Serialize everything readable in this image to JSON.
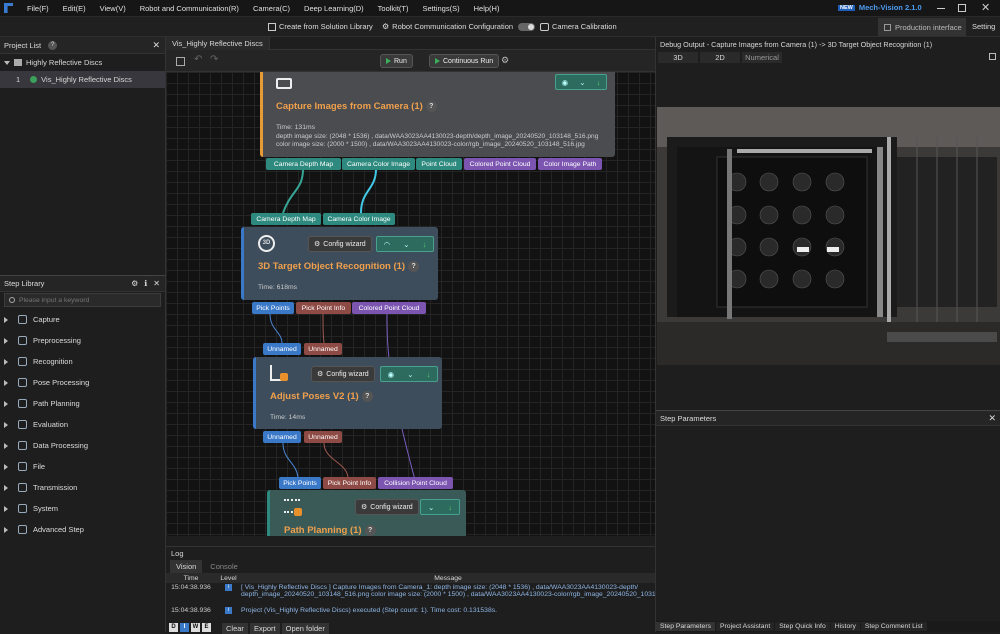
{
  "menu": [
    "File(F)",
    "Edit(E)",
    "View(V)",
    "Robot and Communication(R)",
    "Camera(C)",
    "Deep Learning(D)",
    "Toolkit(T)",
    "Settings(S)",
    "Help(H)"
  ],
  "app_badge": "NEW",
  "app_title": "Mech-Vision 2.1.0",
  "toolbar": {
    "create_solution": "Create from Solution Library",
    "robot_comm": "Robot Communication Configuration",
    "camera_calib": "Camera Calibration",
    "production_interface": "Production interface",
    "setting": "Setting"
  },
  "project_list": {
    "title": "Project List",
    "root": "Highly Reflective Discs",
    "items": [
      {
        "index": "1",
        "label": "Vis_Highly Reflective Discs"
      }
    ]
  },
  "step_library": {
    "title": "Step Library",
    "search_placeholder": "Please input a keyword",
    "items": [
      "Capture",
      "Preprocessing",
      "Recognition",
      "Pose Processing",
      "Path Planning",
      "Evaluation",
      "Data Processing",
      "File",
      "Transmission",
      "System",
      "Advanced Step"
    ]
  },
  "editor": {
    "tab": "Vis_Highly Reflective Discs",
    "run": "Run",
    "continuous_run": "Continuous Run"
  },
  "nodes": {
    "capture": {
      "title": "Capture Images from Camera (1)",
      "time": "Time: 131ms",
      "line1": "depth image size: (2048 * 1536) , data/WAA3023AA4130023-depth/depth_image_20240520_103148_516.png",
      "line2": "color image size: (2000 * 1500) , data/WAA3023AA4130023-color/rgb_image_20240520_103148_516.jpg",
      "outputs": [
        "Camera Depth Map",
        "Camera Color Image",
        "Point Cloud",
        "Colored Point Cloud",
        "Color Image Path"
      ]
    },
    "recog": {
      "inputs": [
        "Camera Depth Map",
        "Camera Color Image"
      ],
      "title": "3D Target Object Recognition (1)",
      "config": "Config wizard",
      "time": "Time: 618ms",
      "outputs": [
        "Pick Points",
        "Pick Point Info",
        "Colored Point Cloud"
      ]
    },
    "adjust": {
      "inputs": [
        "Unnamed",
        "Unnamed"
      ],
      "title": "Adjust Poses V2 (1)",
      "config": "Config wizard",
      "time": "Time: 14ms",
      "outputs": [
        "Unnamed",
        "Unnamed"
      ]
    },
    "path": {
      "inputs": [
        "Pick Points",
        "Pick Point Info",
        "Collision Point Cloud"
      ],
      "title": "Path Planning (1)",
      "config": "Config wizard"
    }
  },
  "debug": {
    "title": "Debug Output - Capture Images from Camera (1) -> 3D Target Object Recognition (1)",
    "tabs": [
      "3D",
      "2D",
      "Numerical"
    ]
  },
  "step_params": {
    "title": "Step Parameters",
    "bottom_tabs": [
      "Step Parameters",
      "Project Assistant",
      "Step Quick Info",
      "History",
      "Step Comment List"
    ]
  },
  "log": {
    "title": "Log",
    "tabs": [
      "Vision",
      "Console"
    ],
    "headers": [
      "Time",
      "Level",
      "Message"
    ],
    "rows": [
      {
        "time": "15:04:38.936",
        "msg1": "[ Vis_Highly Reflective Discs ] Capture Images from Camera_1: depth image size: (2048 * 1536) , data/WAA3023AA4130023-depth/",
        "msg2": "depth_image_20240520_103148_516.png color image size: (2000 * 1500) , data/WAA3023AA4130023-color/rgb_image_20240520_103148_516.jpg"
      },
      {
        "time": "15:04:38.936",
        "msg1": "Project (Vis_Highly Reflective Discs) executed (Step count: 1). Time cost: 0.131538s."
      }
    ],
    "level_filters": [
      "D",
      "I",
      "W",
      "E"
    ],
    "actions": [
      "Clear",
      "Export",
      "Open folder"
    ]
  },
  "colors": {
    "teal": "#2e8a7e",
    "purple": "#7b55b0",
    "blue": "#3a78c8",
    "red": "#8e4a44",
    "accent_orange": "#f0a04c"
  }
}
